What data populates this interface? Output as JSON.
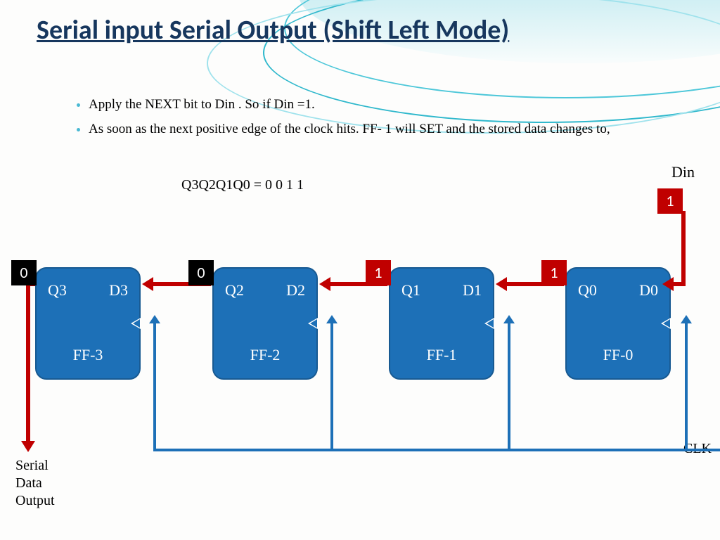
{
  "title": "Serial input Serial Output (Shift Left Mode)",
  "bullets": [
    "Apply the NEXT  bit to Din . So if Din =1.",
    "As soon as the next positive edge of the clock hits. FF- 1 will SET and the stored data changes to,"
  ],
  "equation": "Q3Q2Q1Q0 = 0 0 1 1",
  "labels": {
    "din": "Din",
    "clk": "CLK",
    "serial_out_l1": "Serial",
    "serial_out_l2": "Data",
    "serial_out_l3": "Output"
  },
  "flipflops": [
    {
      "name": "FF-3",
      "q": "Q3",
      "d": "D3"
    },
    {
      "name": "FF-2",
      "q": "Q2",
      "d": "D2"
    },
    {
      "name": "FF-1",
      "q": "Q1",
      "d": "D1"
    },
    {
      "name": "FF-0",
      "q": "Q0",
      "d": "D0"
    }
  ],
  "bits": {
    "q3": {
      "value": "0",
      "color": "black"
    },
    "q2": {
      "value": "0",
      "color": "black"
    },
    "q1": {
      "value": "1",
      "color": "red"
    },
    "q0": {
      "value": "1",
      "color": "red"
    },
    "din": {
      "value": "1",
      "color": "red"
    }
  }
}
